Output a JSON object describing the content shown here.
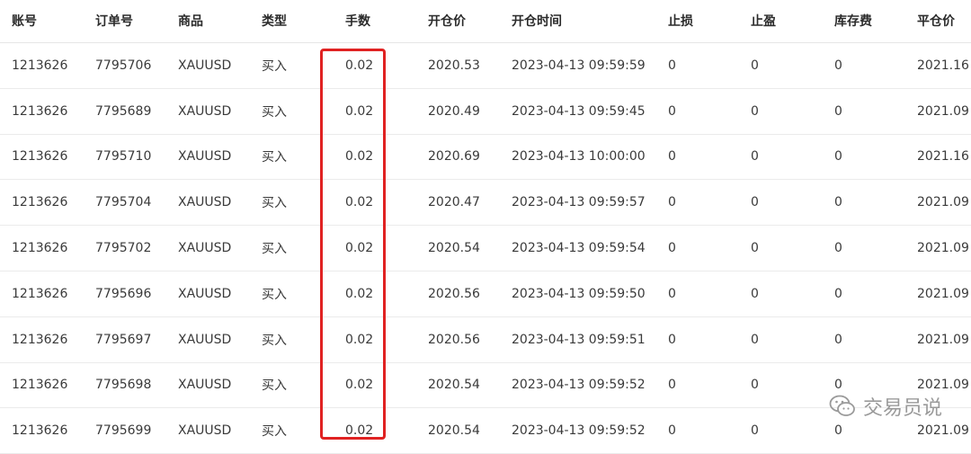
{
  "headers": [
    "账号",
    "订单号",
    "商品",
    "类型",
    "手数",
    "开仓价",
    "开仓时间",
    "止损",
    "止盈",
    "库存费",
    "平仓价"
  ],
  "rows": [
    [
      "1213626",
      "7795706",
      "XAUUSD",
      "买入",
      "0.02",
      "2020.53",
      "2023-04-13 09:59:59",
      "0",
      "0",
      "0",
      "2021.16"
    ],
    [
      "1213626",
      "7795689",
      "XAUUSD",
      "买入",
      "0.02",
      "2020.49",
      "2023-04-13 09:59:45",
      "0",
      "0",
      "0",
      "2021.09"
    ],
    [
      "1213626",
      "7795710",
      "XAUUSD",
      "买入",
      "0.02",
      "2020.69",
      "2023-04-13 10:00:00",
      "0",
      "0",
      "0",
      "2021.16"
    ],
    [
      "1213626",
      "7795704",
      "XAUUSD",
      "买入",
      "0.02",
      "2020.47",
      "2023-04-13 09:59:57",
      "0",
      "0",
      "0",
      "2021.09"
    ],
    [
      "1213626",
      "7795702",
      "XAUUSD",
      "买入",
      "0.02",
      "2020.54",
      "2023-04-13 09:59:54",
      "0",
      "0",
      "0",
      "2021.09"
    ],
    [
      "1213626",
      "7795696",
      "XAUUSD",
      "买入",
      "0.02",
      "2020.56",
      "2023-04-13 09:59:50",
      "0",
      "0",
      "0",
      "2021.09"
    ],
    [
      "1213626",
      "7795697",
      "XAUUSD",
      "买入",
      "0.02",
      "2020.56",
      "2023-04-13 09:59:51",
      "0",
      "0",
      "0",
      "2021.09"
    ],
    [
      "1213626",
      "7795698",
      "XAUUSD",
      "买入",
      "0.02",
      "2020.54",
      "2023-04-13 09:59:52",
      "0",
      "0",
      "0",
      "2021.09"
    ],
    [
      "1213626",
      "7795699",
      "XAUUSD",
      "买入",
      "0.02",
      "2020.54",
      "2023-04-13 09:59:52",
      "0",
      "0",
      "0",
      "2021.09"
    ]
  ],
  "watermark": {
    "text": "交易员说",
    "icon": "wechat-icon"
  },
  "colors": {
    "highlight": "#e02222",
    "row_border": "#ebebeb",
    "watermark": "#9a9a9a"
  }
}
